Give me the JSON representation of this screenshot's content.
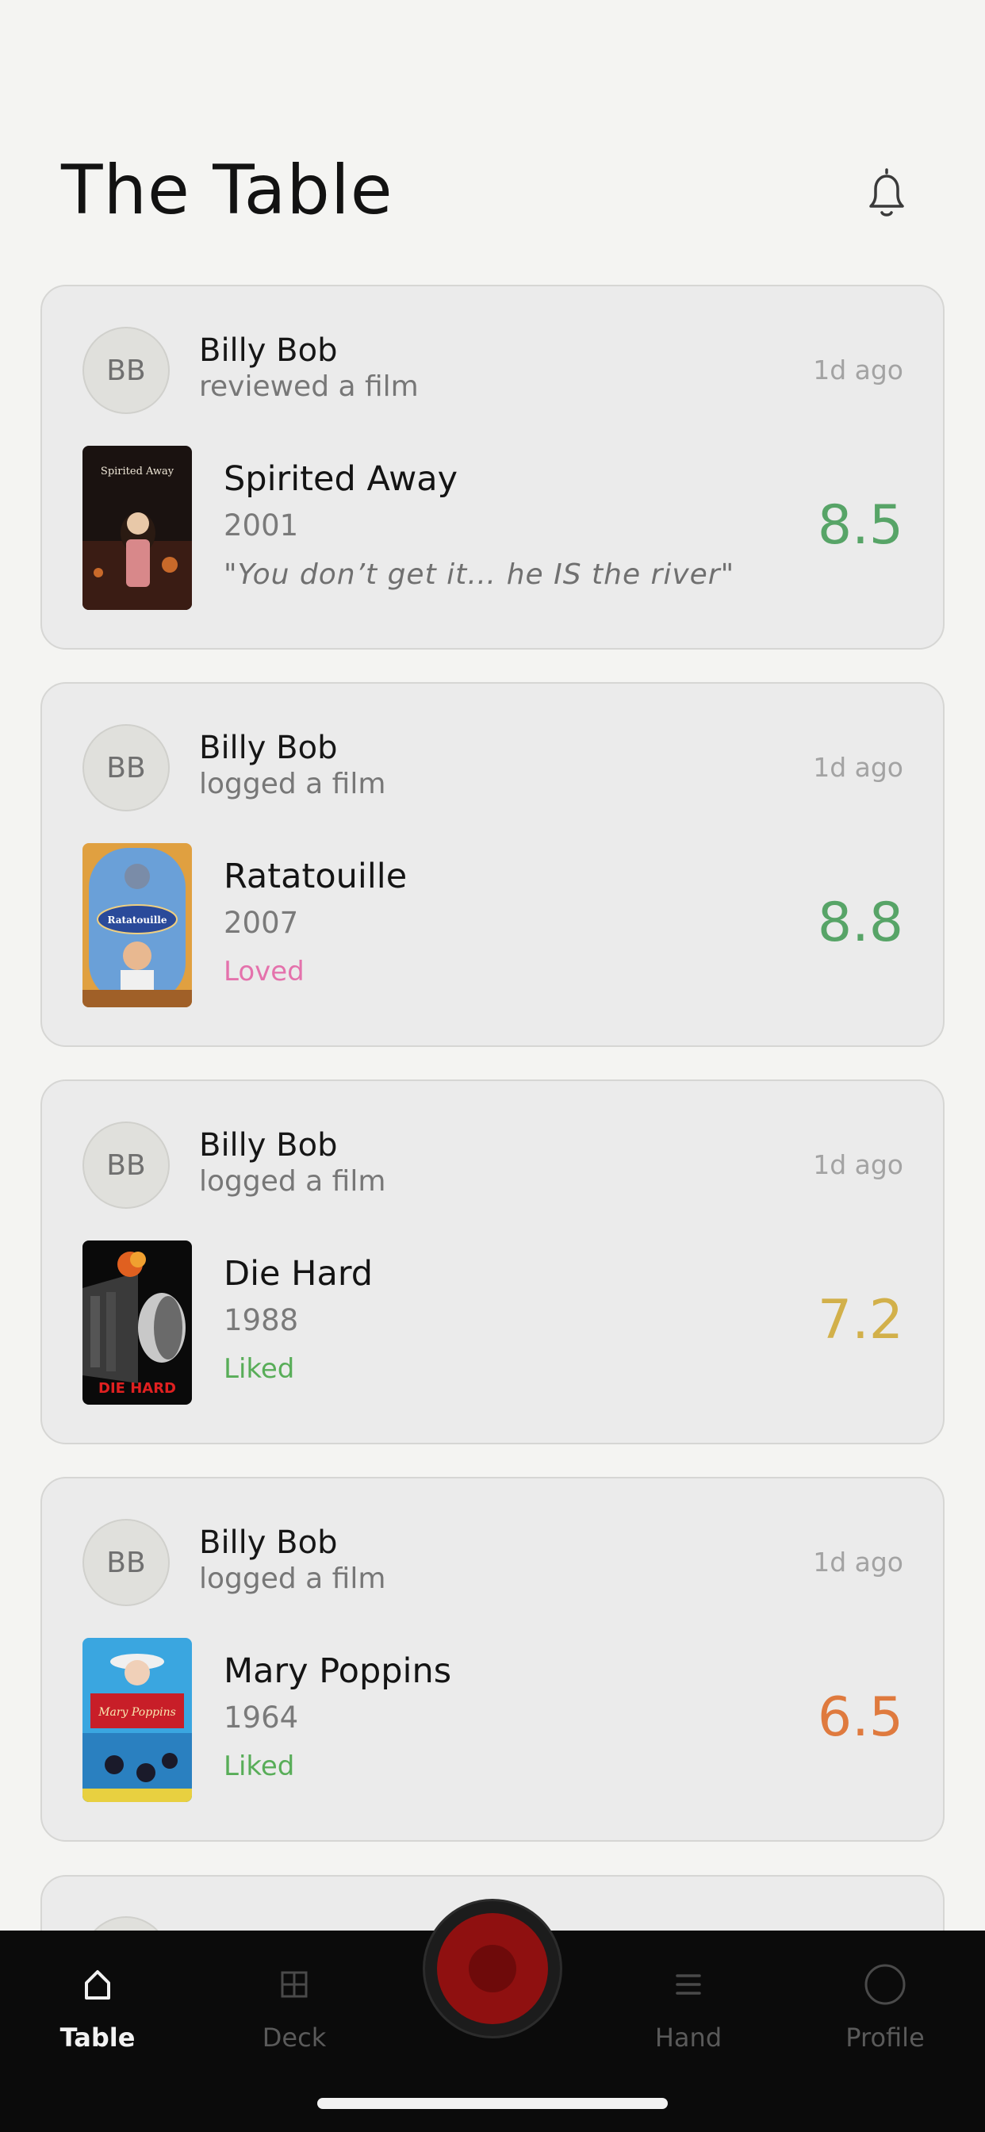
{
  "header": {
    "title": "The Table",
    "icon": "bell-icon"
  },
  "feed": [
    {
      "avatar": "BB",
      "user": "Billy Bob",
      "action": "reviewed a film",
      "time": "1d ago",
      "title": "Spirited Away",
      "year": "2001",
      "extra": "\"You don’t get it… he IS the river\"",
      "extra_type": "quote",
      "poster_text": "Spirited Away",
      "rating": "8.5",
      "rating_color": "#57a467"
    },
    {
      "avatar": "BB",
      "user": "Billy Bob",
      "action": "logged a film",
      "time": "1d ago",
      "title": "Ratatouille",
      "year": "2007",
      "extra": "Loved",
      "extra_type": "loved",
      "poster_text": "Ratatouille",
      "rating": "8.8",
      "rating_color": "#57a467"
    },
    {
      "avatar": "BB",
      "user": "Billy Bob",
      "action": "logged a film",
      "time": "1d ago",
      "title": "Die Hard",
      "year": "1988",
      "extra": "Liked",
      "extra_type": "liked",
      "poster_text": "DIE HARD",
      "rating": "7.2",
      "rating_color": "#d2b04a"
    },
    {
      "avatar": "BB",
      "user": "Billy Bob",
      "action": "logged a film",
      "time": "1d ago",
      "title": "Mary Poppins",
      "year": "1964",
      "extra": "Liked",
      "extra_type": "liked",
      "poster_text": "Mary Poppins",
      "rating": "6.5",
      "rating_color": "#df7a3e"
    }
  ],
  "tabs": [
    {
      "label": "Table",
      "icon": "home-icon",
      "active": true
    },
    {
      "label": "Deck",
      "icon": "grid-icon",
      "active": false
    },
    {
      "label": "record",
      "icon": "record-button",
      "active": false
    },
    {
      "label": "Hand",
      "icon": "list-icon",
      "active": false
    },
    {
      "label": "Profile",
      "icon": "profile-icon",
      "active": false
    }
  ]
}
